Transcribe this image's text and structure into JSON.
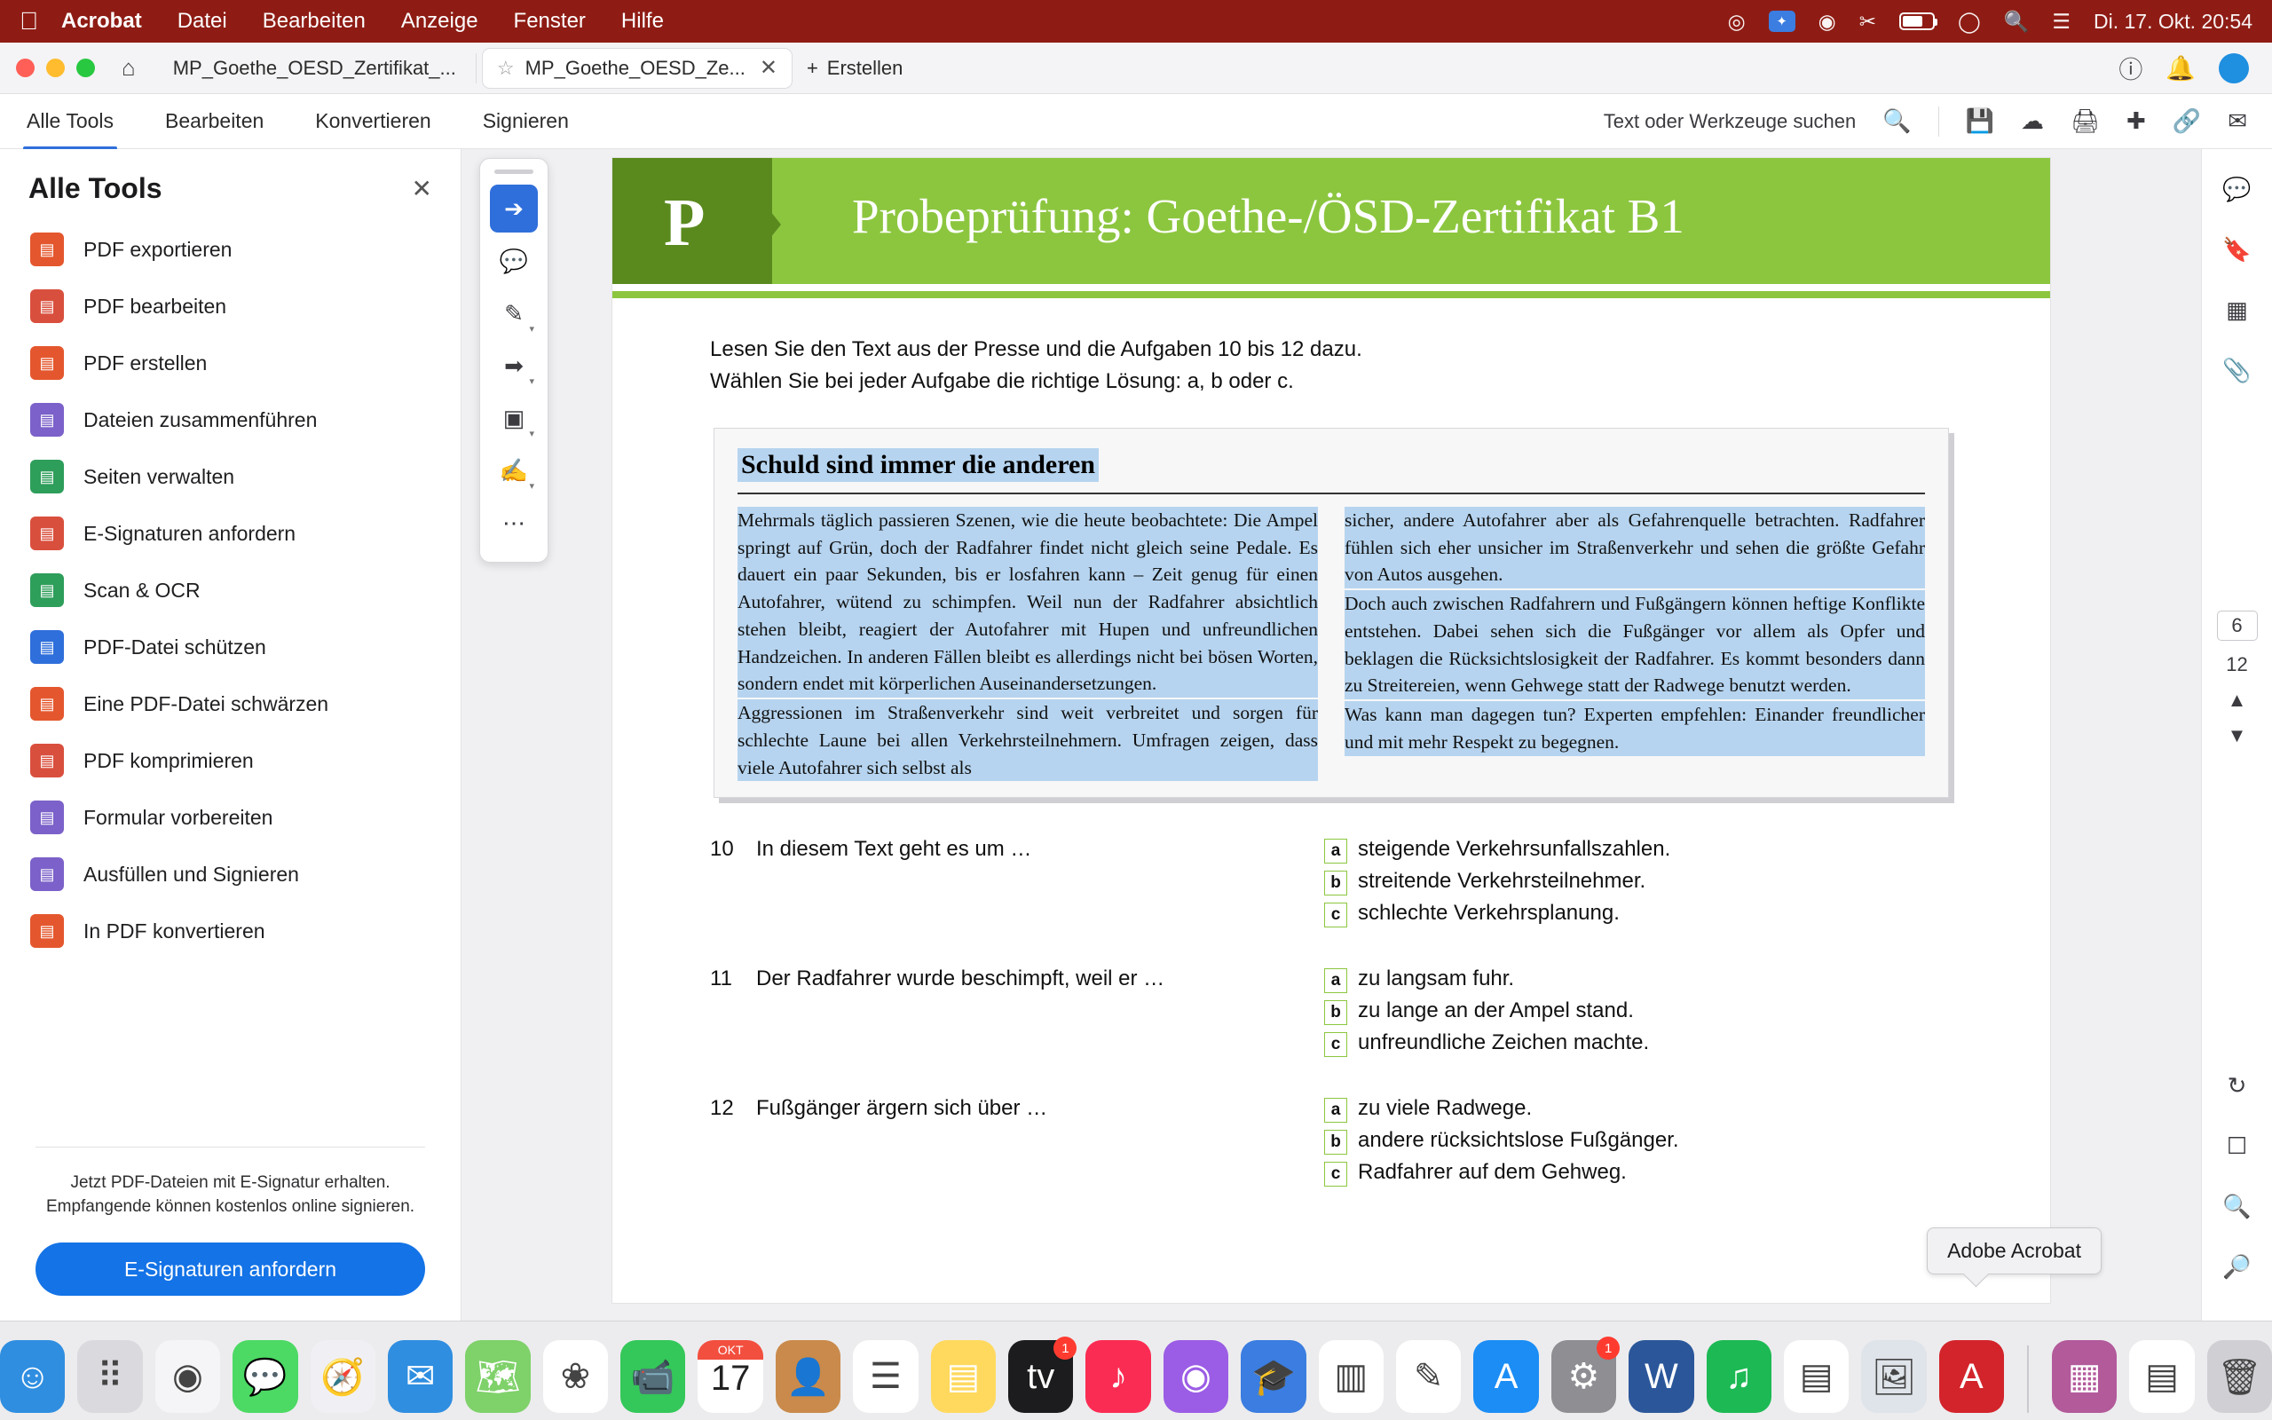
{
  "menubar": {
    "apple": "apple-logo",
    "app": "Acrobat",
    "items": [
      "Datei",
      "Bearbeiten",
      "Anzeige",
      "Fenster",
      "Hilfe"
    ],
    "status_datetime": "Di. 17. Okt.  20:54",
    "icons": [
      "record-icon",
      "dropbox-icon",
      "shield-icon",
      "scissors-icon",
      "battery-icon",
      "wifi-icon",
      "search-icon",
      "control-center-icon"
    ]
  },
  "window": {
    "tabs": [
      {
        "title": "MP_Goethe_OESD_Zertifikat_...",
        "active": false
      },
      {
        "title": "MP_Goethe_OESD_Ze...",
        "active": true
      }
    ],
    "new_tab_label": "Erstellen",
    "home_icon": "home-icon",
    "right_icons": [
      "help-icon",
      "bell-icon",
      "account-avatar"
    ]
  },
  "toolbar": {
    "tabs": [
      "Alle Tools",
      "Bearbeiten",
      "Konvertieren",
      "Signieren"
    ],
    "active_tab": "Alle Tools",
    "search_label": "Text oder Werkzeuge suchen",
    "icons": [
      "search-icon",
      "save-icon",
      "cloud-upload-icon",
      "print-icon",
      "add-stamp-icon",
      "link-icon",
      "mail-icon"
    ]
  },
  "sidebar": {
    "title": "Alle Tools",
    "close_icon": "close-icon",
    "items": [
      {
        "label": "PDF exportieren",
        "icon": "export-pdf-icon",
        "color": "#e4572e"
      },
      {
        "label": "PDF bearbeiten",
        "icon": "edit-pdf-icon",
        "color": "#d94f3d"
      },
      {
        "label": "PDF erstellen",
        "icon": "create-pdf-icon",
        "color": "#e4572e"
      },
      {
        "label": "Dateien zusammenführen",
        "icon": "merge-files-icon",
        "color": "#7b61c9"
      },
      {
        "label": "Seiten verwalten",
        "icon": "manage-pages-icon",
        "color": "#2e9e5b"
      },
      {
        "label": "E-Signaturen anfordern",
        "icon": "request-signature-icon",
        "color": "#d94f3d"
      },
      {
        "label": "Scan & OCR",
        "icon": "scan-ocr-icon",
        "color": "#2e9e5b"
      },
      {
        "label": "PDF-Datei schützen",
        "icon": "protect-pdf-icon",
        "color": "#2f6fdb"
      },
      {
        "label": "Eine PDF-Datei schwärzen",
        "icon": "redact-pdf-icon",
        "color": "#e4572e"
      },
      {
        "label": "PDF komprimieren",
        "icon": "compress-pdf-icon",
        "color": "#d94f3d"
      },
      {
        "label": "Formular vorbereiten",
        "icon": "prepare-form-icon",
        "color": "#7b61c9"
      },
      {
        "label": "Ausfüllen und Signieren",
        "icon": "fill-sign-icon",
        "color": "#7b61c9"
      },
      {
        "label": "In PDF konvertieren",
        "icon": "convert-to-pdf-icon",
        "color": "#e4572e"
      }
    ],
    "promo_text": "Jetzt PDF-Dateien mit E-Signatur erhalten. Empfangende können kostenlos online signieren.",
    "promo_button": "E-Signaturen anfordern"
  },
  "palette": {
    "tools": [
      {
        "icon": "select-cursor-icon",
        "selected": true
      },
      {
        "icon": "add-comment-icon",
        "selected": false
      },
      {
        "icon": "highlight-pen-icon",
        "selected": false
      },
      {
        "icon": "draw-freehand-icon",
        "selected": false
      },
      {
        "icon": "add-text-box-icon",
        "selected": false
      },
      {
        "icon": "signature-icon",
        "selected": false
      },
      {
        "icon": "more-tools-icon",
        "selected": false
      }
    ]
  },
  "document": {
    "banner_letter": "P",
    "banner_title": "Probeprüfung: Goethe-/ÖSD-Zertifikat B1",
    "instructions": [
      "Lesen Sie den Text aus der Presse und die Aufgaben 10 bis 12 dazu.",
      "Wählen Sie bei jeder Aufgabe die richtige Lösung: a, b oder c."
    ],
    "article": {
      "title": "Schuld sind immer die anderen",
      "column_left": [
        "Mehrmals täglich passieren Szenen, wie die heute beobachtete: Die Ampel springt auf Grün, doch der Radfahrer findet nicht gleich seine Pedale. Es dauert ein paar Sekunden, bis er losfahren kann – Zeit genug für einen Autofahrer, wütend zu schimpfen. Weil nun der Radfahrer absichtlich stehen bleibt, reagiert der Autofahrer mit Hupen und unfreundlichen Handzeichen. In anderen Fällen bleibt es allerdings nicht bei bösen Worten, sondern endet mit körperlichen Auseinandersetzungen.",
        "Aggressionen im Straßenverkehr sind weit verbreitet und sorgen für schlechte Laune bei allen Verkehrsteilnehmern. Umfragen zeigen, dass viele Autofahrer sich selbst als"
      ],
      "column_right": [
        "sicher, andere Autofahrer aber als Gefahrenquelle betrachten. Radfahrer fühlen sich eher unsicher im Straßenverkehr und sehen die größte Gefahr von Autos ausgehen.",
        "Doch auch zwischen Radfahrern und Fußgängern können heftige Konflikte entstehen. Dabei sehen sich die Fußgänger vor allem als Opfer und beklagen die Rücksichtslosigkeit der Radfahrer. Es kommt besonders dann zu Streitereien, wenn Gehwege statt der Radwege benutzt werden.",
        "Was kann man dagegen tun? Experten empfehlen: Einander freundlicher und mit mehr Respekt zu begegnen."
      ]
    },
    "questions": [
      {
        "number": "10",
        "text": "In diesem Text geht es um …",
        "options": [
          {
            "key": "a",
            "text": "steigende Verkehrsunfallszahlen."
          },
          {
            "key": "b",
            "text": "streitende Verkehrsteilnehmer."
          },
          {
            "key": "c",
            "text": "schlechte Verkehrsplanung."
          }
        ]
      },
      {
        "number": "11",
        "text": "Der Radfahrer wurde beschimpft, weil er …",
        "options": [
          {
            "key": "a",
            "text": "zu langsam fuhr."
          },
          {
            "key": "b",
            "text": "zu lange an der Ampel stand."
          },
          {
            "key": "c",
            "text": "unfreundliche Zeichen machte."
          }
        ]
      },
      {
        "number": "12",
        "text": "Fußgänger ärgern sich über …",
        "options": [
          {
            "key": "a",
            "text": "zu viele Radwege."
          },
          {
            "key": "b",
            "text": "andere rücksichtslose Fußgänger."
          },
          {
            "key": "c",
            "text": "Radfahrer auf dem Gehweg."
          }
        ]
      }
    ]
  },
  "right_rail": {
    "icons": [
      "comment-icon",
      "bookmark-icon",
      "thumbnails-icon",
      "attachments-icon"
    ],
    "current_page": "6",
    "total_pages": "12",
    "nav_icons": [
      "page-up-icon",
      "page-down-icon"
    ],
    "bottom_icons": [
      "rotate-icon",
      "fit-page-icon",
      "zoom-in-icon",
      "zoom-out-icon"
    ]
  },
  "tooltip": {
    "text": "Adobe Acrobat"
  },
  "dock": {
    "items": [
      {
        "name": "finder",
        "glyph": "☺",
        "color": "#2f8ee0",
        "badge": ""
      },
      {
        "name": "launchpad",
        "glyph": "⠿",
        "color": "#d9d9de",
        "badge": ""
      },
      {
        "name": "chrome",
        "glyph": "◉",
        "color": "#f5f5f7",
        "badge": ""
      },
      {
        "name": "messages",
        "glyph": "💬",
        "color": "#4cd964",
        "badge": ""
      },
      {
        "name": "safari",
        "glyph": "🧭",
        "color": "#f0f0f4",
        "badge": ""
      },
      {
        "name": "mail",
        "glyph": "✉",
        "color": "#2f8ee0",
        "badge": ""
      },
      {
        "name": "maps",
        "glyph": "🗺",
        "color": "#7fd16a",
        "badge": ""
      },
      {
        "name": "photos",
        "glyph": "❀",
        "color": "#ffffff",
        "badge": ""
      },
      {
        "name": "facetime",
        "glyph": "📹",
        "color": "#34c759",
        "badge": ""
      },
      {
        "name": "calendar",
        "glyph": "17",
        "color": "#ffffff",
        "badge": "",
        "month": "OKT"
      },
      {
        "name": "contacts",
        "glyph": "👤",
        "color": "#c98a4b",
        "badge": ""
      },
      {
        "name": "reminders",
        "glyph": "☰",
        "color": "#ffffff",
        "badge": ""
      },
      {
        "name": "notes",
        "glyph": "▤",
        "color": "#ffd95e",
        "badge": ""
      },
      {
        "name": "apple-tv",
        "glyph": "tv",
        "color": "#1c1c1e",
        "badge": "1"
      },
      {
        "name": "music",
        "glyph": "♪",
        "color": "#fb2c53",
        "badge": ""
      },
      {
        "name": "podcasts",
        "glyph": "◉",
        "color": "#9b5de5",
        "badge": ""
      },
      {
        "name": "app-store-edu",
        "glyph": "🎓",
        "color": "#3b7de0",
        "badge": ""
      },
      {
        "name": "numbers",
        "glyph": "▥",
        "color": "#ffffff",
        "badge": ""
      },
      {
        "name": "pages",
        "glyph": "✎",
        "color": "#ffffff",
        "badge": ""
      },
      {
        "name": "app-store",
        "glyph": "A",
        "color": "#1b8df5",
        "badge": ""
      },
      {
        "name": "system-settings",
        "glyph": "⚙",
        "color": "#8e8e93",
        "badge": "1"
      },
      {
        "name": "word",
        "glyph": "W",
        "color": "#2b579a",
        "badge": ""
      },
      {
        "name": "spotify",
        "glyph": "♫",
        "color": "#1db954",
        "badge": ""
      },
      {
        "name": "textedit",
        "glyph": "▤",
        "color": "#ffffff",
        "badge": ""
      },
      {
        "name": "preview",
        "glyph": "🖼",
        "color": "#dfe4ea",
        "badge": ""
      },
      {
        "name": "acrobat",
        "glyph": "A",
        "color": "#d3242b",
        "badge": ""
      },
      {
        "name": "downloads-stack",
        "glyph": "▦",
        "color": "#b35a9b",
        "badge": ""
      },
      {
        "name": "documents-stack",
        "glyph": "▤",
        "color": "#ffffff",
        "badge": ""
      },
      {
        "name": "trash",
        "glyph": "🗑",
        "color": "#cfcfd4",
        "badge": ""
      }
    ]
  }
}
